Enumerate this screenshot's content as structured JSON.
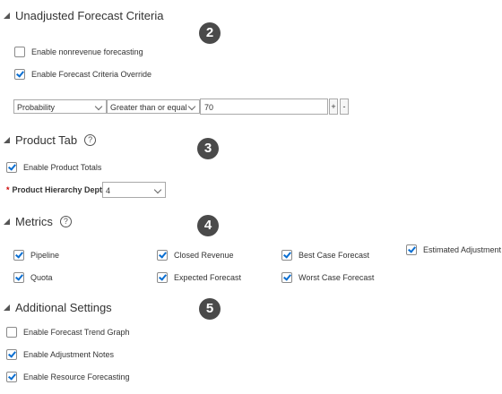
{
  "sections": {
    "unadjusted": {
      "title": "Unadjusted Forecast Criteria",
      "badge": "2"
    },
    "product_tab": {
      "title": "Product Tab",
      "badge": "3",
      "help": "?"
    },
    "metrics": {
      "title": "Metrics",
      "badge": "4",
      "help": "?"
    },
    "additional": {
      "title": "Additional Settings",
      "badge": "5"
    }
  },
  "unadjusted": {
    "nonrevenue": {
      "label": "Enable nonrevenue forecasting",
      "checked": false
    },
    "override": {
      "label": "Enable Forecast Criteria Override",
      "checked": true
    },
    "criteria": {
      "field": "Probability",
      "operator": "Greater than or equal",
      "value": "70",
      "add_label": "+",
      "remove_label": "-"
    }
  },
  "product_tab": {
    "totals": {
      "label": "Enable Product Totals",
      "checked": true
    },
    "depth_label": "Product Hierarchy Depth",
    "depth_required": "*",
    "depth_value": "4"
  },
  "metrics": {
    "pipeline": {
      "label": "Pipeline",
      "checked": true
    },
    "closed_revenue": {
      "label": "Closed Revenue",
      "checked": true
    },
    "best_case": {
      "label": "Best Case Forecast",
      "checked": true
    },
    "estimated_adjustment": {
      "label": "Estimated Adjustment",
      "checked": true
    },
    "quota": {
      "label": "Quota",
      "checked": true
    },
    "expected": {
      "label": "Expected Forecast",
      "checked": true
    },
    "worst_case": {
      "label": "Worst Case Forecast",
      "checked": true
    }
  },
  "additional": {
    "trend_graph": {
      "label": "Enable Forecast Trend Graph",
      "checked": false
    },
    "adjustment_notes": {
      "label": "Enable Adjustment Notes",
      "checked": true
    },
    "resource_forecasting": {
      "label": "Enable Resource Forecasting",
      "checked": true
    }
  },
  "colors": {
    "check": "#0a6ed1",
    "badge": "#4a4a4a"
  }
}
